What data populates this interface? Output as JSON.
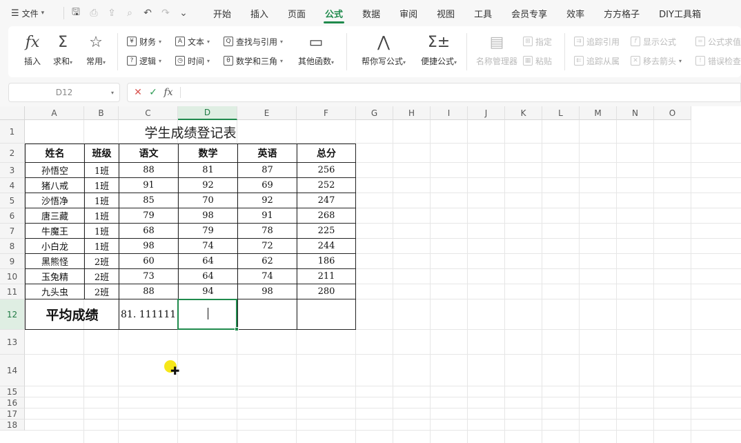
{
  "menu": {
    "file_label": "文件",
    "tabs": [
      "开始",
      "插入",
      "页面",
      "公式",
      "数据",
      "审阅",
      "视图",
      "工具",
      "会员专享",
      "效率",
      "方方格子",
      "DIY工具箱"
    ],
    "active_tab": "公式"
  },
  "ribbon": {
    "insert": "插入",
    "sum": "求和",
    "common": "常用",
    "finance": "财务",
    "text": "文本",
    "lookup": "查找与引用",
    "logic": "逻辑",
    "time": "时间",
    "math": "数学和三角",
    "other_funcs": "其他函数",
    "help_write": "帮你写公式",
    "quick_formula": "便捷公式",
    "name_manager": "名称管理器",
    "define": "指定",
    "paste": "粘贴",
    "trace_precedents": "追踪引用",
    "trace_dependents": "追踪从属",
    "show_formula": "显示公式",
    "remove_arrows": "移去箭头",
    "formula_eval": "公式求值",
    "error_check": "错误检查"
  },
  "formula_bar": {
    "name_box": "D12",
    "fx_label": "fx",
    "content": ""
  },
  "grid": {
    "columns": [
      "A",
      "B",
      "C",
      "D",
      "E",
      "F",
      "G",
      "H",
      "I",
      "J",
      "K",
      "L",
      "M",
      "N",
      "O"
    ],
    "rows": [
      "1",
      "2",
      "3",
      "4",
      "5",
      "6",
      "7",
      "8",
      "9",
      "10",
      "11",
      "12",
      "13",
      "14",
      "15",
      "16",
      "17",
      "18"
    ],
    "selected_column": "D",
    "selected_row": "12"
  },
  "sheet": {
    "title": "学生成绩登记表",
    "headers": [
      "姓名",
      "班级",
      "语文",
      "数学",
      "英语",
      "总分"
    ],
    "rows": [
      [
        "孙悟空",
        "1班",
        "88",
        "81",
        "87",
        "256"
      ],
      [
        "猪八戒",
        "1班",
        "91",
        "92",
        "69",
        "252"
      ],
      [
        "沙悟净",
        "1班",
        "85",
        "70",
        "92",
        "247"
      ],
      [
        "唐三藏",
        "1班",
        "79",
        "98",
        "91",
        "268"
      ],
      [
        "牛魔王",
        "1班",
        "68",
        "79",
        "78",
        "225"
      ],
      [
        "小白龙",
        "1班",
        "98",
        "74",
        "72",
        "244"
      ],
      [
        "黑熊怪",
        "2班",
        "60",
        "64",
        "62",
        "186"
      ],
      [
        "玉兔精",
        "2班",
        "73",
        "64",
        "74",
        "211"
      ],
      [
        "九头虫",
        "2班",
        "88",
        "94",
        "98",
        "280"
      ]
    ],
    "average_label": "平均成绩",
    "average_chinese": "81. 111111"
  }
}
